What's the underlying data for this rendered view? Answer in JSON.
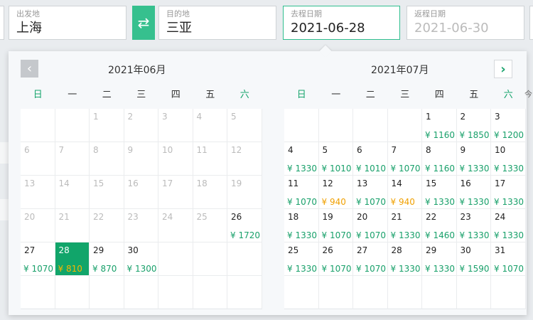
{
  "search": {
    "from": {
      "label": "出发地",
      "value": "上海"
    },
    "to": {
      "label": "目的地",
      "value": "三亚"
    },
    "depart": {
      "label": "去程日期",
      "value": "2021-06-28"
    },
    "return": {
      "label": "返程日期",
      "value": "2021-06-30"
    },
    "swap_icon": "swap-arrows-icon"
  },
  "calendar": {
    "weekdays": [
      "日",
      "一",
      "二",
      "三",
      "四",
      "五",
      "六"
    ],
    "weekday_cut": "今",
    "prev_icon": "chevron-left-icon",
    "next_icon": "chevron-right-icon",
    "months": [
      {
        "title": "2021年06月",
        "cells": [
          {},
          {},
          {
            "d": "1",
            "dis": true
          },
          {
            "d": "2",
            "dis": true
          },
          {
            "d": "3",
            "dis": true
          },
          {
            "d": "4",
            "dis": true
          },
          {
            "d": "5",
            "dis": true
          },
          {
            "d": "6",
            "dis": true
          },
          {
            "d": "7",
            "dis": true
          },
          {
            "d": "8",
            "dis": true
          },
          {
            "d": "9",
            "dis": true
          },
          {
            "d": "10",
            "dis": true
          },
          {
            "d": "11",
            "dis": true
          },
          {
            "d": "12",
            "dis": true
          },
          {
            "d": "13",
            "dis": true
          },
          {
            "d": "14",
            "dis": true
          },
          {
            "d": "15",
            "dis": true
          },
          {
            "d": "16",
            "dis": true
          },
          {
            "d": "17",
            "dis": true
          },
          {
            "d": "18",
            "dis": true
          },
          {
            "d": "19",
            "dis": true
          },
          {
            "d": "20",
            "dis": true
          },
          {
            "d": "21",
            "dis": true
          },
          {
            "d": "22",
            "dis": true
          },
          {
            "d": "23",
            "dis": true
          },
          {
            "d": "24",
            "dis": true
          },
          {
            "d": "25",
            "dis": true
          },
          {
            "d": "26",
            "p": "¥ 1720"
          },
          {
            "d": "27",
            "p": "¥ 1070"
          },
          {
            "d": "28",
            "p": "¥ 810",
            "sel": true,
            "low": true
          },
          {
            "d": "29",
            "p": "¥ 870"
          },
          {
            "d": "30",
            "p": "¥ 1300"
          },
          {},
          {},
          {},
          {},
          {},
          {},
          {},
          {},
          {},
          {}
        ]
      },
      {
        "title": "2021年07月",
        "cells": [
          {},
          {},
          {},
          {},
          {
            "d": "1",
            "p": "¥ 1160"
          },
          {
            "d": "2",
            "p": "¥ 1850"
          },
          {
            "d": "3",
            "p": "¥ 1200"
          },
          {
            "d": "4",
            "p": "¥ 1330"
          },
          {
            "d": "5",
            "p": "¥ 1010"
          },
          {
            "d": "6",
            "p": "¥ 1010"
          },
          {
            "d": "7",
            "p": "¥ 1070"
          },
          {
            "d": "8",
            "p": "¥ 1160"
          },
          {
            "d": "9",
            "p": "¥ 1330"
          },
          {
            "d": "10",
            "p": "¥ 1330"
          },
          {
            "d": "11",
            "p": "¥ 1070"
          },
          {
            "d": "12",
            "p": "¥ 940",
            "low": true
          },
          {
            "d": "13",
            "p": "¥ 1070"
          },
          {
            "d": "14",
            "p": "¥ 940",
            "low": true
          },
          {
            "d": "15",
            "p": "¥ 1330"
          },
          {
            "d": "16",
            "p": "¥ 1330"
          },
          {
            "d": "17",
            "p": "¥ 1330"
          },
          {
            "d": "18",
            "p": "¥ 1330"
          },
          {
            "d": "19",
            "p": "¥ 1070"
          },
          {
            "d": "20",
            "p": "¥ 1070"
          },
          {
            "d": "21",
            "p": "¥ 1330"
          },
          {
            "d": "22",
            "p": "¥ 1460"
          },
          {
            "d": "23",
            "p": "¥ 1330"
          },
          {
            "d": "24",
            "p": "¥ 1330"
          },
          {
            "d": "25",
            "p": "¥ 1330"
          },
          {
            "d": "26",
            "p": "¥ 1070"
          },
          {
            "d": "27",
            "p": "¥ 1070"
          },
          {
            "d": "28",
            "p": "¥ 1330"
          },
          {
            "d": "29",
            "p": "¥ 1330"
          },
          {
            "d": "30",
            "p": "¥ 1590"
          },
          {
            "d": "31",
            "p": "¥ 1070"
          },
          {},
          {},
          {},
          {},
          {},
          {},
          {}
        ]
      }
    ]
  },
  "colors": {
    "accent": "#11a56a",
    "price": "#18a06a",
    "low_price": "#f0a000"
  }
}
